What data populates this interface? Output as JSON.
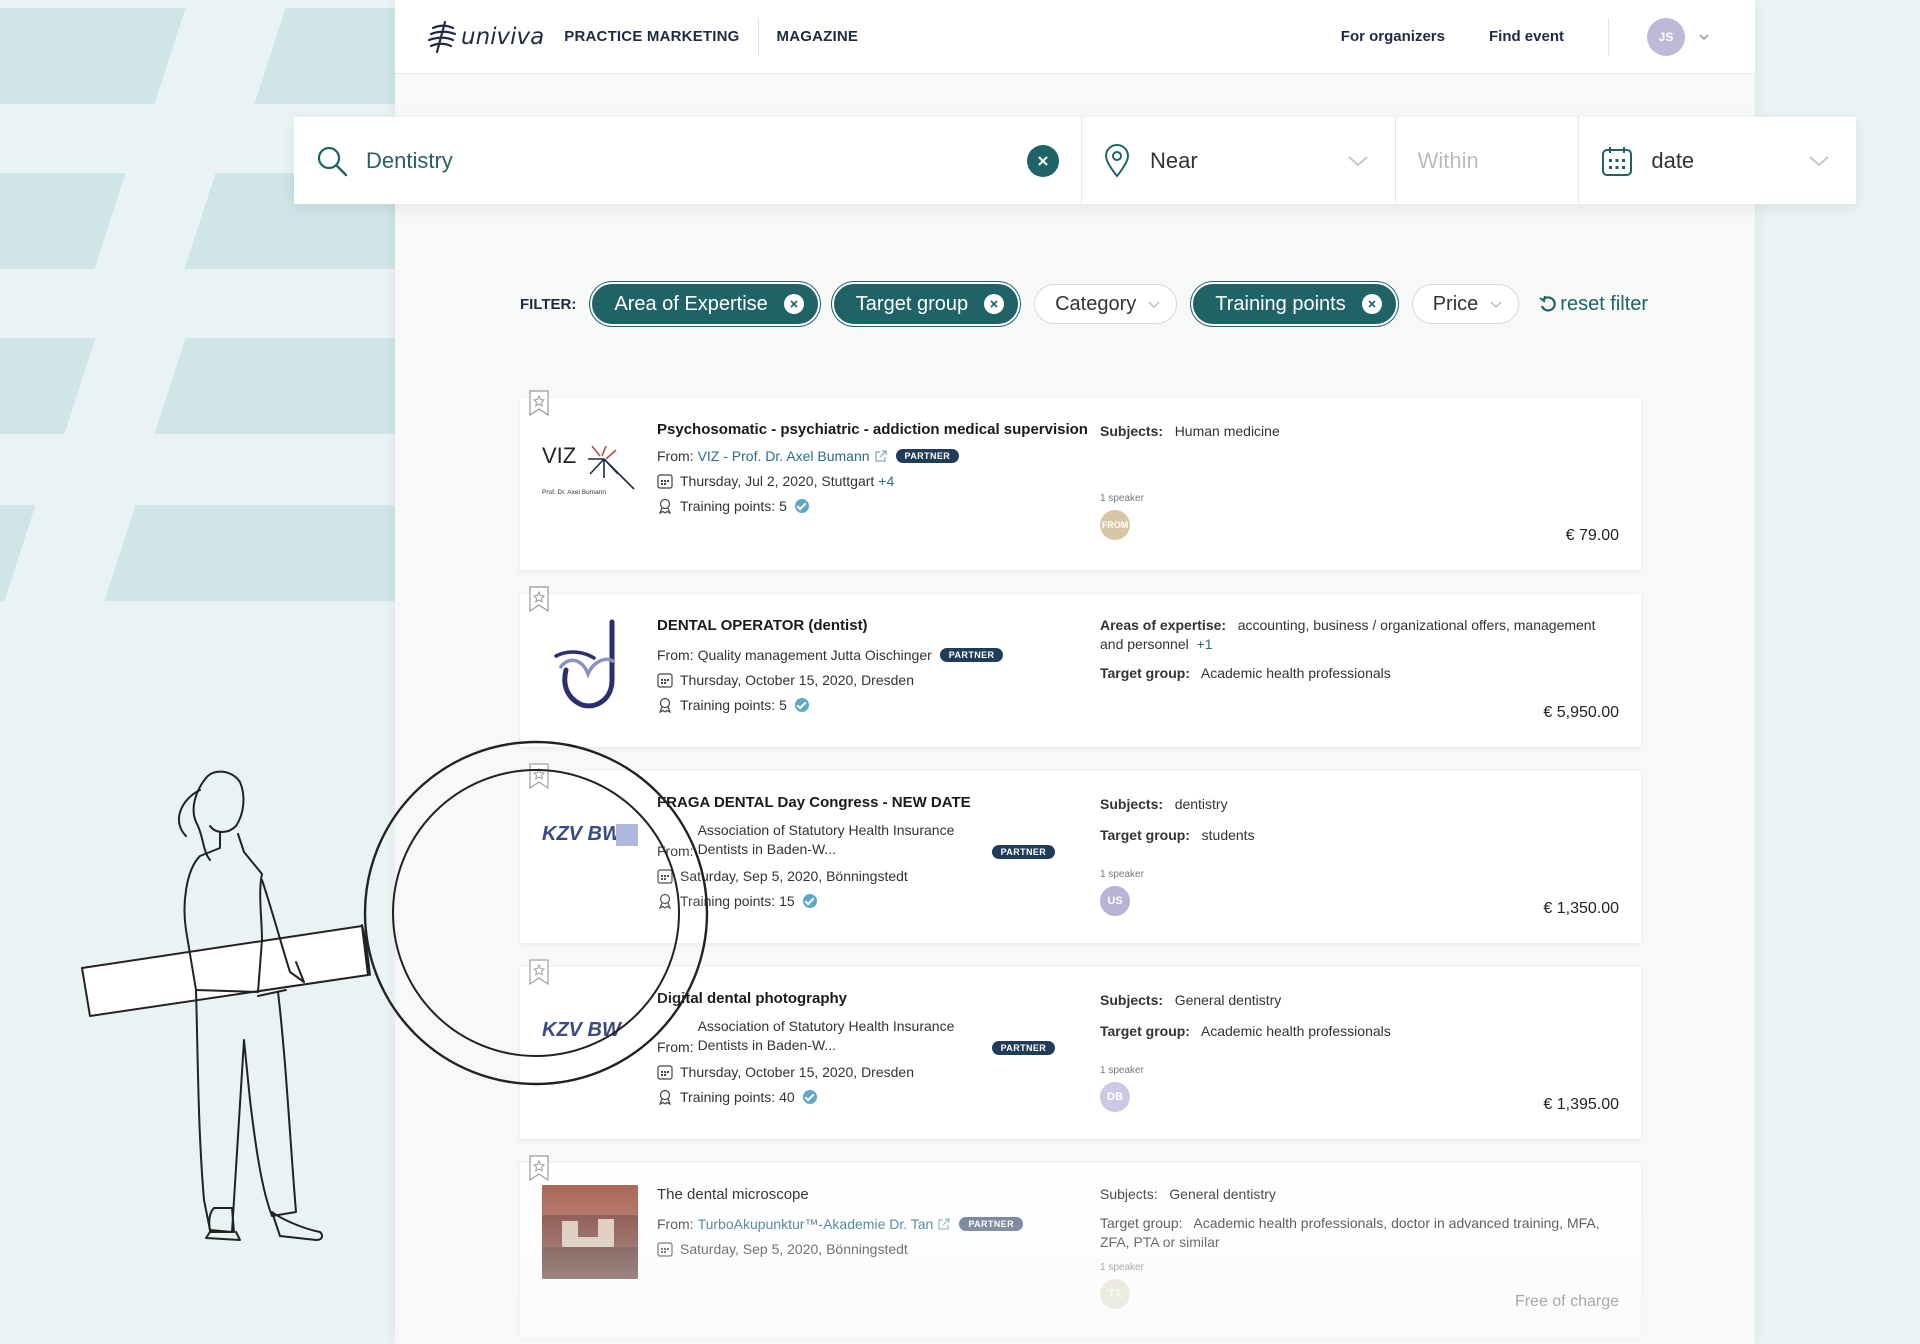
{
  "brand": {
    "name": "univiva"
  },
  "nav": {
    "practice_marketing": "PRACTICE MARKETING",
    "magazine": "MAGAZINE",
    "for_organizers": "For organizers",
    "find_event": "Find event"
  },
  "user": {
    "initials": "JS"
  },
  "search": {
    "query": "Dentistry",
    "near_placeholder": "Near",
    "within_placeholder": "Within",
    "date_placeholder": "date"
  },
  "filters": {
    "label": "FILTER:",
    "chips": [
      {
        "label": "Area of Expertise",
        "active": true
      },
      {
        "label": "Target group",
        "active": true
      },
      {
        "label": "Category",
        "active": false
      },
      {
        "label": "Training points",
        "active": true
      },
      {
        "label": "Price",
        "active": false
      }
    ],
    "reset_label": "reset filter"
  },
  "events": [
    {
      "title": "Psychosomatic - psychiatric - addiction medical supervision",
      "from_prefix": "From:",
      "organizer": "VIZ - Prof. Dr. Axel Bumann",
      "partner_badge": "PARTNER",
      "date": "Thursday, Jul 2, 2020, Stuttgart",
      "date_extra": "+4",
      "training_points": "Training points: 5",
      "subjects_label": "Subjects:",
      "subjects": "Human medicine",
      "speaker_count": "1 speaker",
      "speaker_initials": "FROM",
      "price": "€ 79.00",
      "logo_text": "VIZ",
      "logo_sub": "Prof. Dr. Axel Bumann"
    },
    {
      "title": "DENTAL OPERATOR (dentist)",
      "from_prefix": "From:",
      "organizer": "Quality management Jutta Oischinger",
      "partner_badge": "PARTNER",
      "date": "Thursday, October 15, 2020, Dresden",
      "training_points": "Training points: 5",
      "areas_label": "Areas of expertise:",
      "areas": "accounting, business / organizational offers, management and personnel",
      "areas_extra": "+1",
      "target_label": "Target group:",
      "target": "Academic health professionals",
      "price": "€ 5,950.00"
    },
    {
      "title": "FRAGA DENTAL Day Congress - NEW DATE",
      "from_prefix": "From:",
      "organizer": "Association of Statutory Health Insurance Dentists in Baden-W...",
      "partner_badge": "PARTNER",
      "date": "Saturday, Sep 5, 2020, Bönningstedt",
      "training_points": "Training points: 15",
      "subjects_label": "Subjects:",
      "subjects": "dentistry",
      "target_label": "Target group:",
      "target": "students",
      "speaker_count": "1 speaker",
      "speaker_initials": "US",
      "price": "€ 1,350.00",
      "logo_text": "KZV BW"
    },
    {
      "title": "Digital dental photography",
      "from_prefix": "From:",
      "organizer": "Association of Statutory Health Insurance Dentists in Baden-W...",
      "partner_badge": "PARTNER",
      "date": "Thursday, October 15, 2020, Dresden",
      "training_points": "Training points: 40",
      "subjects_label": "Subjects:",
      "subjects": "General dentistry",
      "target_label": "Target group:",
      "target": "Academic health professionals",
      "speaker_count": "1 speaker",
      "speaker_initials": "DB",
      "price": "€ 1,395.00",
      "logo_text": "KZV BW"
    },
    {
      "title": "The dental microscope",
      "from_prefix": "From:",
      "organizer": "TurboAkupunktur™-Akademie Dr. Tan",
      "partner_badge": "PARTNER",
      "date": "Saturday, Sep 5, 2020, Bönningstedt",
      "subjects_label": "Subjects:",
      "subjects": "General dentistry",
      "target_label": "Target group:",
      "target": "Academic health professionals, doctor in advanced training, MFA, ZFA, PTA or similar",
      "speaker_count": "1 speaker",
      "speaker_initials": "TT",
      "price": "Free of charge"
    }
  ],
  "colors": {
    "accent": "#1f6366",
    "navy": "#1f2a44",
    "partner": "#1f3c5a",
    "link": "#2a6b8a",
    "background": "#e9f3f4"
  }
}
